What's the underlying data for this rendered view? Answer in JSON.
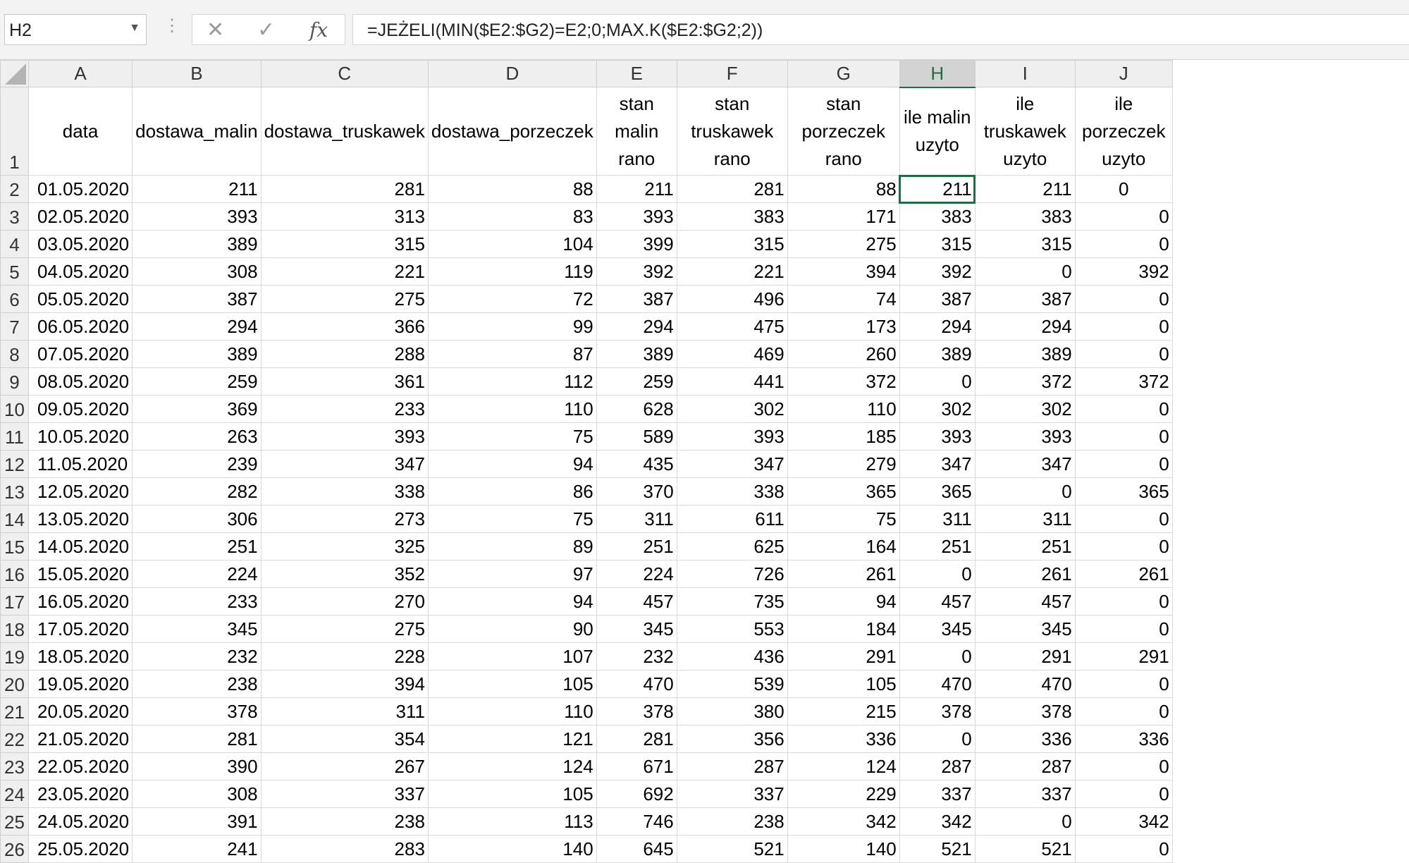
{
  "formula_bar": {
    "name_box": "H2",
    "separator": "⋮",
    "cancel": "✕",
    "enter": "✓",
    "fx": "fx",
    "formula": "=JEŻELI(MIN($E2:$G2)=E2;0;MAX.K($E2:$G2;2))"
  },
  "columns": [
    "A",
    "B",
    "C",
    "D",
    "E",
    "F",
    "G",
    "H",
    "I",
    "J"
  ],
  "headers": [
    "data",
    "dostawa_malin",
    "dostawa_truskawek",
    "dostawa_porzeczek",
    "stan malin rano",
    "stan truskawek rano",
    "stan porzeczek rano",
    "ile malin uzyto",
    "ile truskawek uzyto",
    "ile porzeczek uzyto"
  ],
  "header_row_number": "1",
  "rows": [
    {
      "n": "2",
      "c": [
        "01.05.2020",
        "211",
        "281",
        "88",
        "211",
        "281",
        "88",
        "211",
        "211",
        "0"
      ]
    },
    {
      "n": "3",
      "c": [
        "02.05.2020",
        "393",
        "313",
        "83",
        "393",
        "383",
        "171",
        "383",
        "383",
        "0"
      ]
    },
    {
      "n": "4",
      "c": [
        "03.05.2020",
        "389",
        "315",
        "104",
        "399",
        "315",
        "275",
        "315",
        "315",
        "0"
      ]
    },
    {
      "n": "5",
      "c": [
        "04.05.2020",
        "308",
        "221",
        "119",
        "392",
        "221",
        "394",
        "392",
        "0",
        "392"
      ]
    },
    {
      "n": "6",
      "c": [
        "05.05.2020",
        "387",
        "275",
        "72",
        "387",
        "496",
        "74",
        "387",
        "387",
        "0"
      ]
    },
    {
      "n": "7",
      "c": [
        "06.05.2020",
        "294",
        "366",
        "99",
        "294",
        "475",
        "173",
        "294",
        "294",
        "0"
      ]
    },
    {
      "n": "8",
      "c": [
        "07.05.2020",
        "389",
        "288",
        "87",
        "389",
        "469",
        "260",
        "389",
        "389",
        "0"
      ]
    },
    {
      "n": "9",
      "c": [
        "08.05.2020",
        "259",
        "361",
        "112",
        "259",
        "441",
        "372",
        "0",
        "372",
        "372"
      ]
    },
    {
      "n": "10",
      "c": [
        "09.05.2020",
        "369",
        "233",
        "110",
        "628",
        "302",
        "110",
        "302",
        "302",
        "0"
      ]
    },
    {
      "n": "11",
      "c": [
        "10.05.2020",
        "263",
        "393",
        "75",
        "589",
        "393",
        "185",
        "393",
        "393",
        "0"
      ]
    },
    {
      "n": "12",
      "c": [
        "11.05.2020",
        "239",
        "347",
        "94",
        "435",
        "347",
        "279",
        "347",
        "347",
        "0"
      ]
    },
    {
      "n": "13",
      "c": [
        "12.05.2020",
        "282",
        "338",
        "86",
        "370",
        "338",
        "365",
        "365",
        "0",
        "365"
      ]
    },
    {
      "n": "14",
      "c": [
        "13.05.2020",
        "306",
        "273",
        "75",
        "311",
        "611",
        "75",
        "311",
        "311",
        "0"
      ]
    },
    {
      "n": "15",
      "c": [
        "14.05.2020",
        "251",
        "325",
        "89",
        "251",
        "625",
        "164",
        "251",
        "251",
        "0"
      ]
    },
    {
      "n": "16",
      "c": [
        "15.05.2020",
        "224",
        "352",
        "97",
        "224",
        "726",
        "261",
        "0",
        "261",
        "261"
      ]
    },
    {
      "n": "17",
      "c": [
        "16.05.2020",
        "233",
        "270",
        "94",
        "457",
        "735",
        "94",
        "457",
        "457",
        "0"
      ]
    },
    {
      "n": "18",
      "c": [
        "17.05.2020",
        "345",
        "275",
        "90",
        "345",
        "553",
        "184",
        "345",
        "345",
        "0"
      ]
    },
    {
      "n": "19",
      "c": [
        "18.05.2020",
        "232",
        "228",
        "107",
        "232",
        "436",
        "291",
        "0",
        "291",
        "291"
      ]
    },
    {
      "n": "20",
      "c": [
        "19.05.2020",
        "238",
        "394",
        "105",
        "470",
        "539",
        "105",
        "470",
        "470",
        "0"
      ]
    },
    {
      "n": "21",
      "c": [
        "20.05.2020",
        "378",
        "311",
        "110",
        "378",
        "380",
        "215",
        "378",
        "378",
        "0"
      ]
    },
    {
      "n": "22",
      "c": [
        "21.05.2020",
        "281",
        "354",
        "121",
        "281",
        "356",
        "336",
        "0",
        "336",
        "336"
      ]
    },
    {
      "n": "23",
      "c": [
        "22.05.2020",
        "390",
        "267",
        "124",
        "671",
        "287",
        "124",
        "287",
        "287",
        "0"
      ]
    },
    {
      "n": "24",
      "c": [
        "23.05.2020",
        "308",
        "337",
        "105",
        "692",
        "337",
        "229",
        "337",
        "337",
        "0"
      ]
    },
    {
      "n": "25",
      "c": [
        "24.05.2020",
        "391",
        "238",
        "113",
        "746",
        "238",
        "342",
        "342",
        "0",
        "342"
      ]
    },
    {
      "n": "26",
      "c": [
        "25.05.2020",
        "241",
        "283",
        "140",
        "645",
        "521",
        "140",
        "521",
        "521",
        "0"
      ]
    }
  ],
  "colors": {
    "selection": "#1d6f42",
    "header_bg": "#efefef",
    "grid_line": "#d9d9d9"
  }
}
